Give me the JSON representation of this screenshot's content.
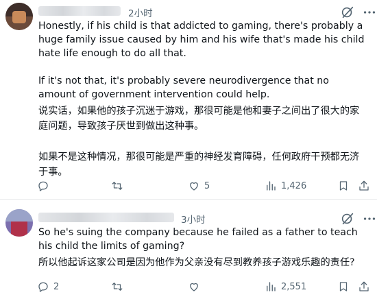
{
  "posts": [
    {
      "timestamp": "2小时",
      "paragraphs_en": [
        "Honestly, if his child is that addicted to gaming, there's probably a huge family issue caused by him and his wife that's made his child hate life enough to do all that.",
        "If it's not that, it's probably severe neurodivergence that no amount of government intervention could help."
      ],
      "paragraphs_zh": [
        "说实话，如果他的孩子沉迷于游戏，那很可能是他和妻子之间出了很大的家庭问题，导致孩子厌世到做出这种事。",
        "如果不是这种情况，那很可能是严重的神经发育障碍，任何政府干预都无济于事。"
      ],
      "actions": {
        "replies": "",
        "reposts": "",
        "likes": "5",
        "views": "1,426"
      }
    },
    {
      "timestamp": "3小时",
      "paragraphs_en": [
        "So he's suing the company because he failed as a father to teach his child the limits of gaming?"
      ],
      "paragraphs_zh": [
        "所以他起诉这家公司是因为他作为父亲没有尽到教养孩子游戏乐趣的责任?"
      ],
      "actions": {
        "replies": "2",
        "reposts": "",
        "likes": "",
        "views": "2,551"
      }
    }
  ],
  "icons": {
    "reply": "reply-icon",
    "repost": "repost-icon",
    "like": "heart-icon",
    "views": "views-icon",
    "bookmark": "bookmark-icon",
    "share": "share-icon",
    "grok": "grok-icon",
    "more": "more-icon"
  },
  "colors": {
    "text": "#0f1419",
    "secondary": "#536471",
    "divider": "#e7e9ea"
  }
}
